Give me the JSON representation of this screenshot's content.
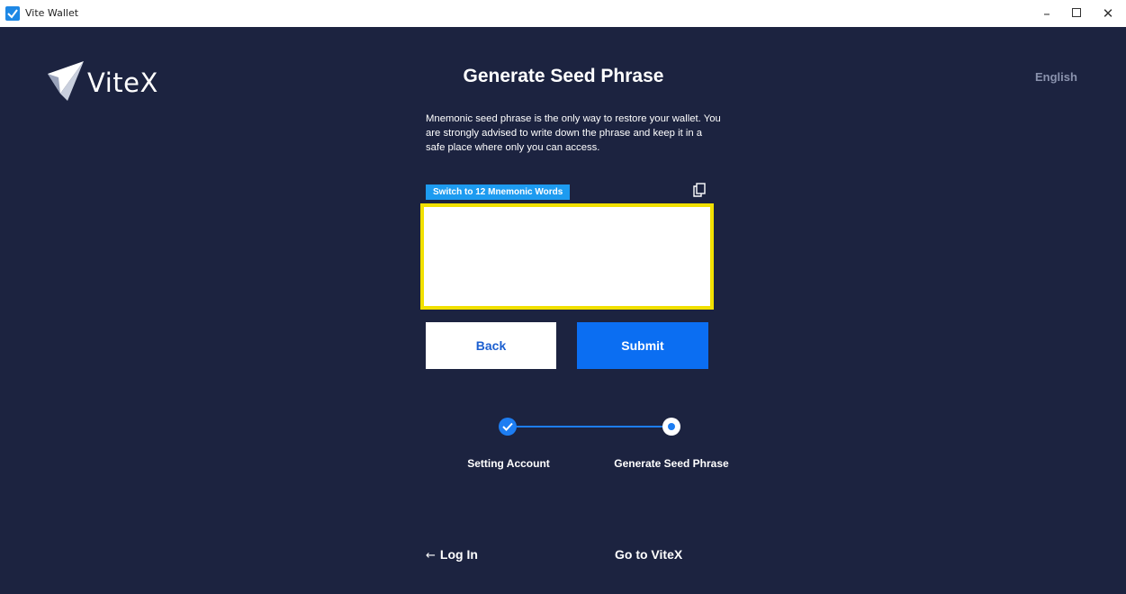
{
  "window": {
    "title": "Vite Wallet",
    "minimize_glyph": "–",
    "close_glyph": "✕",
    "icon": "vite-app-icon"
  },
  "header": {
    "logo_text": "ViteX",
    "language": "English"
  },
  "main": {
    "title": "Generate Seed Phrase",
    "description": "Mnemonic seed phrase is the only way to restore your wallet. You are strongly advised to write down the phrase and keep it in a safe place where only you can access.",
    "switch_label": "Switch to 12 Mnemonic Words",
    "seed_value": "",
    "copy_icon": "copy-icon",
    "back_label": "Back",
    "submit_label": "Submit"
  },
  "steps": [
    {
      "label": "Setting Account",
      "state": "completed"
    },
    {
      "label": "Generate Seed Phrase",
      "state": "current"
    }
  ],
  "footer": {
    "login_arrow": "←",
    "login_label": "Log In",
    "vitex_label": "Go to ViteX"
  },
  "colors": {
    "background": "#1c2340",
    "accent": "#0b6ef2",
    "highlight_border": "#f1e000",
    "switch_button": "#1d9bf0"
  }
}
